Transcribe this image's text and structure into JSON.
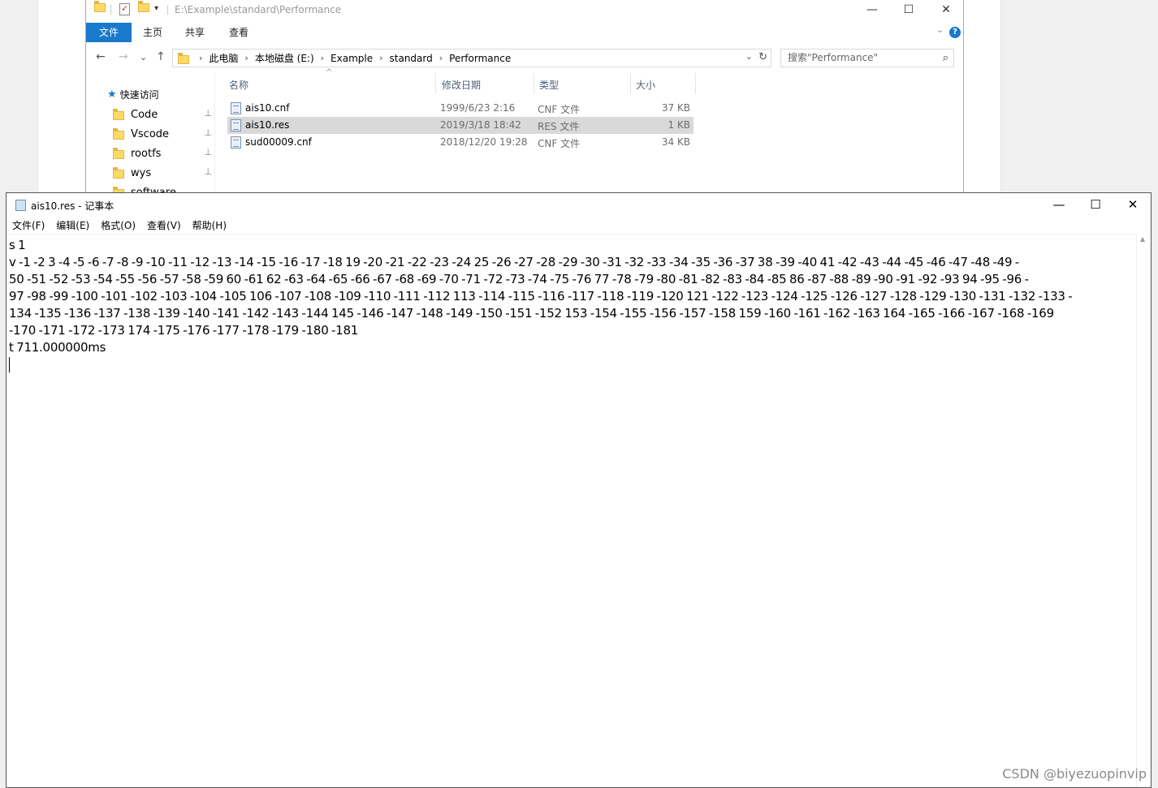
{
  "explorer": {
    "title_path": "E:\\Example\\standard\\Performance",
    "qa_toolbar_dropdown": "▾",
    "window_controls": {
      "minimize": "—",
      "maximize": "☐",
      "close": "✕"
    },
    "ribbon_tabs": {
      "file": "文件",
      "home": "主页",
      "share": "共享",
      "view": "查看"
    },
    "help_icon": "?",
    "ribbon_collapse": "⌄",
    "nav": {
      "back": "←",
      "forward": "→",
      "recent": "⌄",
      "up": "↑"
    },
    "breadcrumb": [
      "此电脑",
      "本地磁盘 (E:)",
      "Example",
      "standard",
      "Performance"
    ],
    "breadcrumb_sep": "›",
    "address_dropdown": "⌄",
    "refresh": "↻",
    "search_placeholder": "搜索\"Performance\"",
    "search_icon": "⌕",
    "sidebar": {
      "quick_access": "快速访问",
      "star_icon": "★",
      "pin_icon": "📌",
      "items": [
        "Code",
        "Vscode",
        "rootfs",
        "wys",
        "software"
      ]
    },
    "columns": {
      "name": "名称",
      "date": "修改日期",
      "type": "类型",
      "size": "大小"
    },
    "sort_indicator": "^",
    "files": [
      {
        "name": "ais10.cnf",
        "date": "1999/6/23 2:16",
        "type": "CNF 文件",
        "size": "37 KB"
      },
      {
        "name": "ais10.res",
        "date": "2019/3/18 18:42",
        "type": "RES 文件",
        "size": "1 KB"
      },
      {
        "name": "sud00009.cnf",
        "date": "2018/12/20 19:28",
        "type": "CNF 文件",
        "size": "34 KB"
      }
    ]
  },
  "notepad": {
    "title": "ais10.res - 记事本",
    "window_controls": {
      "minimize": "—",
      "maximize": "☐",
      "close": "✕"
    },
    "menu": [
      "文件(F)",
      "编辑(E)",
      "格式(O)",
      "查看(V)",
      "帮助(H)"
    ],
    "lines": [
      "s 1",
      "v -1 -2 3 -4 -5 -6 -7 -8 -9 -10 -11 -12 -13 -14 -15 -16 -17 -18 19 -20 -21 -22 -23 -24 25 -26 -27 -28 -29 -30 -31 -32 -33 -34 -35 -36 -37 38 -39 -40 41 -42 -43 -44 -45 -46 -47 -48 -49 -",
      "50 -51 -52 -53 -54 -55 -56 -57 -58 -59 60 -61 62 -63 -64 -65 -66 -67 -68 -69 -70 -71 -72 -73 -74 -75 -76 77 -78 -79 -80 -81 -82 -83 -84 -85 86 -87 -88 -89 -90 -91 -92 -93 94 -95 -96 -",
      "97 -98 -99 -100 -101 -102 -103 -104 -105 106 -107 -108 -109 -110 -111 -112 113 -114 -115 -116 -117 -118 -119 -120 121 -122 -123 -124 -125 -126 -127 -128 -129 -130 -131 -132 -133 -",
      "134 -135 -136 -137 -138 -139 -140 -141 -142 -143 -144 145 -146 -147 -148 -149 -150 -151 -152 153 -154 -155 -156 -157 -158 159 -160 -161 -162 -163 164 -165 -166 -167 -168 -169",
      "-170 -171 -172 -173 174 -175 -176 -177 -178 -179 -180 -181",
      "t 711.000000ms"
    ],
    "scroll_up": "▲"
  },
  "watermark": "CSDN @biyezuopinvip"
}
